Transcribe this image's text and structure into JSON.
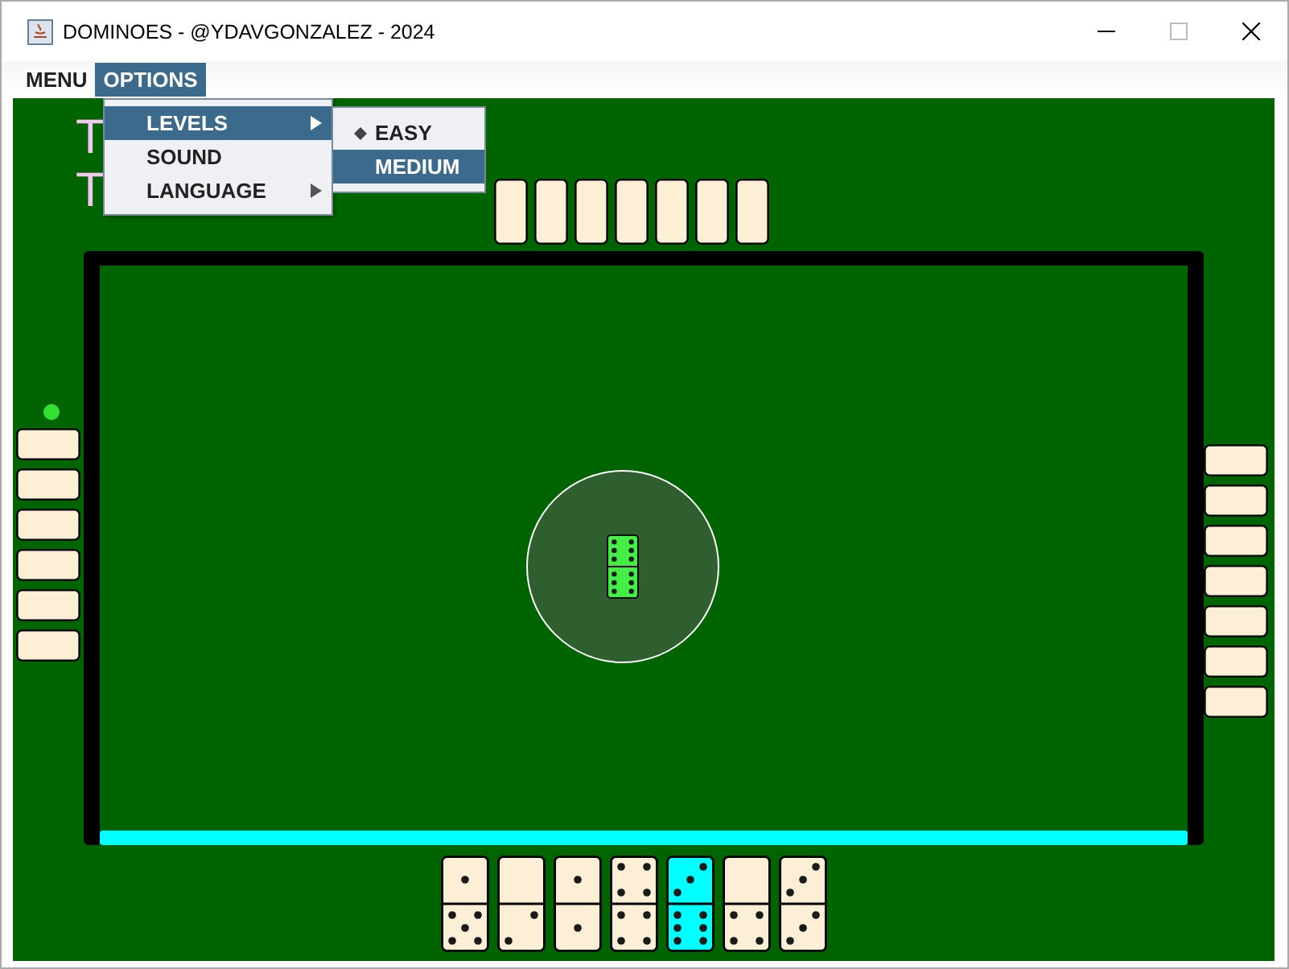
{
  "window": {
    "title": "DOMINOES - @YDAVGONZALEZ - 2024"
  },
  "menu_bar": [
    {
      "label": "MENU",
      "selected": false
    },
    {
      "label": "OPTIONS",
      "selected": true
    }
  ],
  "options_menu": [
    {
      "label": "LEVELS",
      "submenu": true,
      "highlighted": true
    },
    {
      "label": "SOUND",
      "submenu": false,
      "highlighted": false
    },
    {
      "label": "LANGUAGE",
      "submenu": true,
      "highlighted": false
    }
  ],
  "levels_menu": [
    {
      "label": "EASY",
      "selected": true,
      "highlighted": false
    },
    {
      "label": "MEDIUM",
      "selected": false,
      "highlighted": true
    }
  ],
  "score_lines": [
    "T",
    "T"
  ],
  "top_player": {
    "hand": [
      {
        "kind": "back"
      },
      {
        "kind": "back"
      },
      {
        "kind": "back"
      },
      {
        "kind": "back"
      },
      {
        "kind": "back"
      },
      {
        "kind": "back"
      },
      {
        "kind": "back"
      }
    ]
  },
  "left_player": {
    "marker": true,
    "hand": [
      {
        "kind": "back"
      },
      {
        "kind": "back"
      },
      {
        "kind": "back"
      },
      {
        "kind": "back"
      },
      {
        "kind": "back"
      },
      {
        "kind": "back"
      }
    ]
  },
  "right_player": {
    "hand": [
      {
        "kind": "back"
      },
      {
        "kind": "back"
      },
      {
        "kind": "back"
      },
      {
        "kind": "back"
      },
      {
        "kind": "back"
      },
      {
        "kind": "back"
      },
      {
        "kind": "back"
      }
    ]
  },
  "bottom_player": {
    "active": true,
    "hand": [
      {
        "kind": "face",
        "selected": false,
        "top_pips": [
          false,
          false,
          false,
          false,
          true,
          false,
          false,
          false,
          false
        ],
        "bottom_pips": [
          true,
          false,
          true,
          false,
          true,
          false,
          true,
          false,
          true
        ]
      },
      {
        "kind": "face",
        "selected": false,
        "top_pips": [
          false,
          false,
          false,
          false,
          false,
          false,
          false,
          false,
          false
        ],
        "bottom_pips": [
          false,
          false,
          true,
          false,
          false,
          false,
          true,
          false,
          false
        ]
      },
      {
        "kind": "face",
        "selected": false,
        "top_pips": [
          false,
          false,
          false,
          false,
          true,
          false,
          false,
          false,
          false
        ],
        "bottom_pips": [
          false,
          false,
          false,
          false,
          true,
          false,
          false,
          false,
          false
        ]
      },
      {
        "kind": "face",
        "selected": false,
        "top_pips": [
          true,
          false,
          true,
          false,
          false,
          false,
          true,
          false,
          true
        ],
        "bottom_pips": [
          true,
          false,
          true,
          false,
          false,
          false,
          true,
          false,
          true
        ]
      },
      {
        "kind": "face",
        "selected": true,
        "top_pips": [
          false,
          false,
          true,
          false,
          true,
          false,
          true,
          false,
          false
        ],
        "bottom_pips": [
          true,
          false,
          true,
          true,
          false,
          true,
          true,
          false,
          true
        ]
      },
      {
        "kind": "face",
        "selected": false,
        "top_pips": [
          false,
          false,
          false,
          false,
          false,
          false,
          false,
          false,
          false
        ],
        "bottom_pips": [
          true,
          false,
          true,
          false,
          false,
          false,
          true,
          false,
          true
        ]
      },
      {
        "kind": "face",
        "selected": false,
        "top_pips": [
          false,
          false,
          true,
          false,
          true,
          false,
          true,
          false,
          false
        ],
        "bottom_pips": [
          false,
          false,
          true,
          false,
          true,
          false,
          true,
          false,
          false
        ]
      }
    ]
  },
  "board": {
    "tiles": [
      {
        "kind": "face",
        "highlighted": true,
        "top_pips": [
          true,
          false,
          true,
          true,
          false,
          true,
          true,
          false,
          true
        ],
        "bottom_pips": [
          true,
          false,
          true,
          true,
          false,
          true,
          true,
          false,
          true
        ]
      }
    ]
  }
}
